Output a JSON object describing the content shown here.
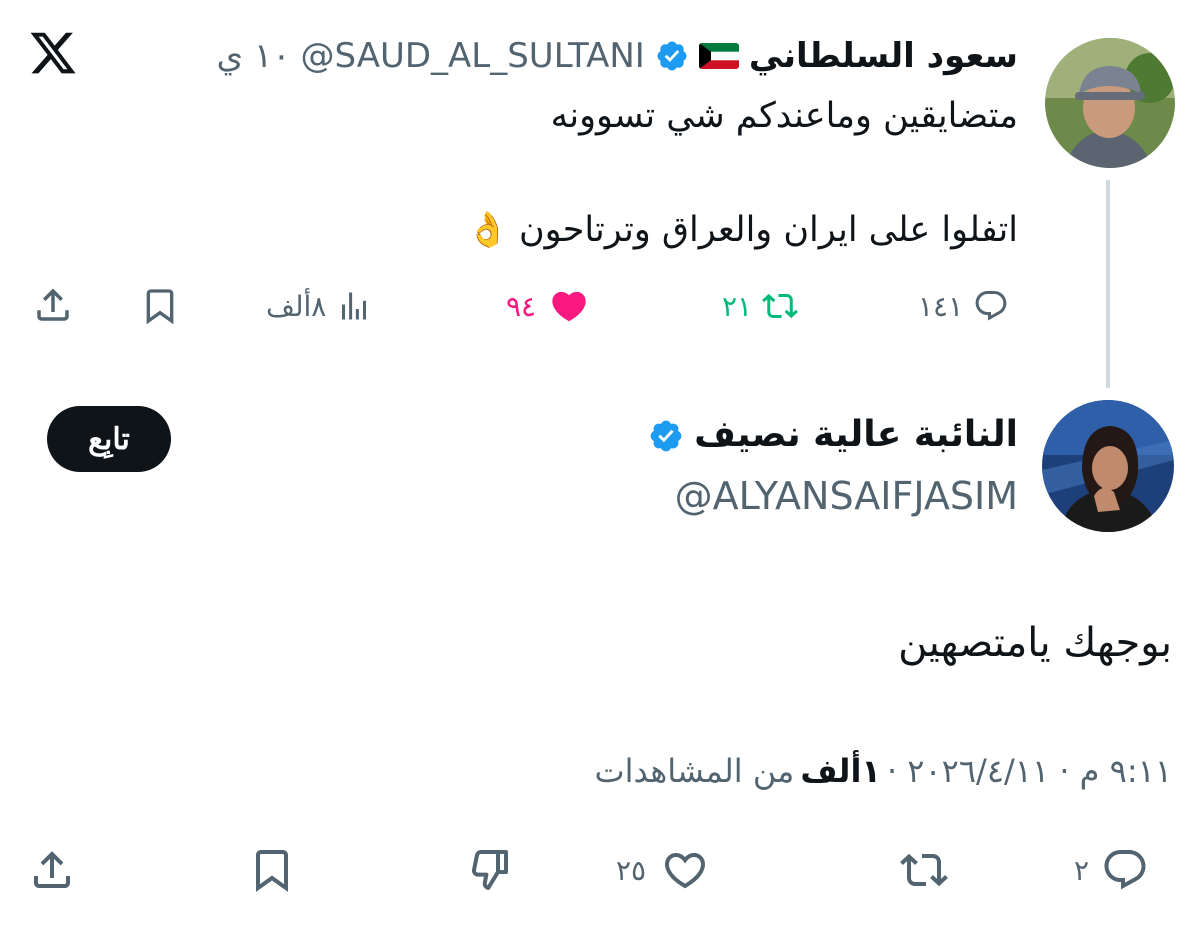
{
  "quoted": {
    "name": "سعود السلطاني",
    "flag": "kuwait-flag",
    "handle": "@SAUD_AL_SULTANI",
    "time": "١٠ ي",
    "line1": "متضايقين وماعندكم شي تسوونه",
    "line2": "اتفلوا على ايران والعراق وترتاحون",
    "emoji": "👌",
    "replies": "١٤١",
    "reposts": "٢١",
    "likes": "٩٤",
    "views": "٨ألف",
    "colors": {
      "repost": "#00ba7c",
      "like": "#f91880"
    }
  },
  "main": {
    "name": "النائبة عالية نصيف",
    "handle": "@ALYANSAIFJASIM",
    "follow_label": "تابِع",
    "text": "بوجهك يامتصهين",
    "timestamp": "٩:١١ م · ٢٠٢٦/٤/١١ ·",
    "views_count": "١ألف",
    "views_label": "من المشاهدات",
    "replies": "٢",
    "likes": "٢٥"
  },
  "colors": {
    "verified": "#1d9bf0",
    "text": "#0f1419",
    "secondary": "#536471"
  }
}
